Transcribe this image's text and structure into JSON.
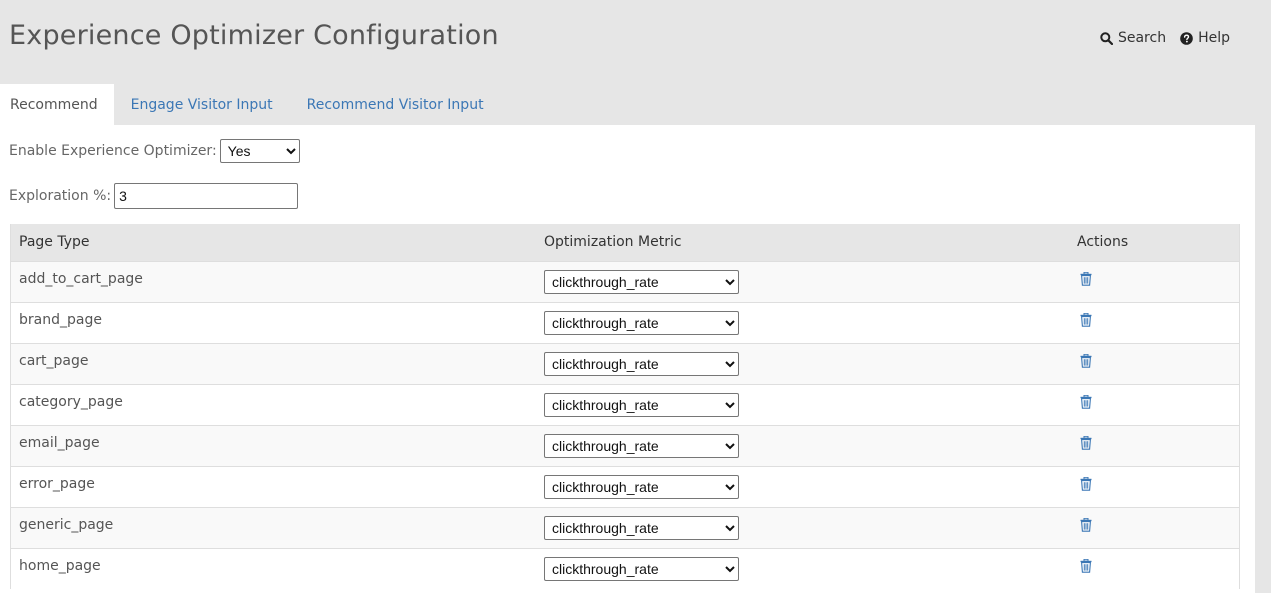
{
  "header": {
    "title": "Experience Optimizer Configuration",
    "search_label": "Search",
    "help_label": "Help"
  },
  "tabs": [
    {
      "label": "Recommend",
      "active": true
    },
    {
      "label": "Engage Visitor Input",
      "active": false
    },
    {
      "label": "Recommend Visitor Input",
      "active": false
    }
  ],
  "form": {
    "enable_label": "Enable Experience Optimizer:",
    "enable_value": "Yes",
    "exploration_label": "Exploration %:",
    "exploration_value": "3"
  },
  "table": {
    "headers": {
      "page_type": "Page Type",
      "metric": "Optimization Metric",
      "actions": "Actions"
    },
    "rows": [
      {
        "page_type": "add_to_cart_page",
        "metric": "clickthrough_rate"
      },
      {
        "page_type": "brand_page",
        "metric": "clickthrough_rate"
      },
      {
        "page_type": "cart_page",
        "metric": "clickthrough_rate"
      },
      {
        "page_type": "category_page",
        "metric": "clickthrough_rate"
      },
      {
        "page_type": "email_page",
        "metric": "clickthrough_rate"
      },
      {
        "page_type": "error_page",
        "metric": "clickthrough_rate"
      },
      {
        "page_type": "generic_page",
        "metric": "clickthrough_rate"
      },
      {
        "page_type": "home_page",
        "metric": "clickthrough_rate"
      }
    ]
  },
  "colors": {
    "background": "#e6e6e6",
    "link": "#3b77b5",
    "trash_icon": "#3b77b5"
  },
  "icons": {
    "search": "search-icon",
    "help": "question-circle-icon",
    "delete": "trash-icon"
  }
}
